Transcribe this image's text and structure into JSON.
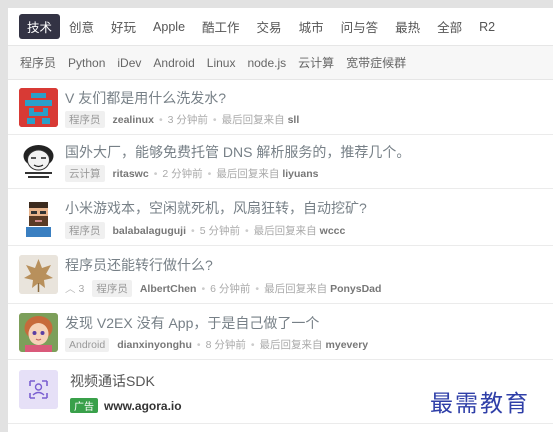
{
  "tabs": [
    "技术",
    "创意",
    "好玩",
    "Apple",
    "酷工作",
    "交易",
    "城市",
    "问与答",
    "最热",
    "全部",
    "R2"
  ],
  "subtabs": [
    "程序员",
    "Python",
    "iDev",
    "Android",
    "Linux",
    "node.js",
    "云计算",
    "宽带症候群"
  ],
  "topics": [
    {
      "title": "V 友们都是用什么洗发水?",
      "node": "程序员",
      "user": "zealinux",
      "time": "3 分钟前",
      "last_label": "最后回复来自",
      "last_user": "sll"
    },
    {
      "title": "国外大厂，能够免费托管 DNS 解析服务的，推荐几个。",
      "node": "云计算",
      "user": "ritaswc",
      "time": "2 分钟前",
      "last_label": "最后回复来自",
      "last_user": "liyuans"
    },
    {
      "title": "小米游戏本，空闲就死机，风扇狂转，自动挖矿?",
      "node": "程序员",
      "user": "balabalaguguji",
      "time": "5 分钟前",
      "last_label": "最后回复来自",
      "last_user": "wccc"
    },
    {
      "title": "程序员还能转行做什么?",
      "votes": "3",
      "node": "程序员",
      "user": "AlbertChen",
      "time": "6 分钟前",
      "last_label": "最后回复来自",
      "last_user": "PonysDad"
    },
    {
      "title": "发现 V2EX 没有 App，于是自己做了一个",
      "node": "Android",
      "user": "dianxinyonghu",
      "time": "8 分钟前",
      "last_label": "最后回复来自",
      "last_user": "myevery"
    }
  ],
  "ad": {
    "title": "视频通话SDK",
    "badge": "广告",
    "url": "www.agora.io"
  },
  "watermark": "最需教育",
  "colors": {
    "active_tab": "#333344",
    "link": "#778087",
    "ad_green": "#39a04a",
    "watermark": "#2f3fa8"
  }
}
